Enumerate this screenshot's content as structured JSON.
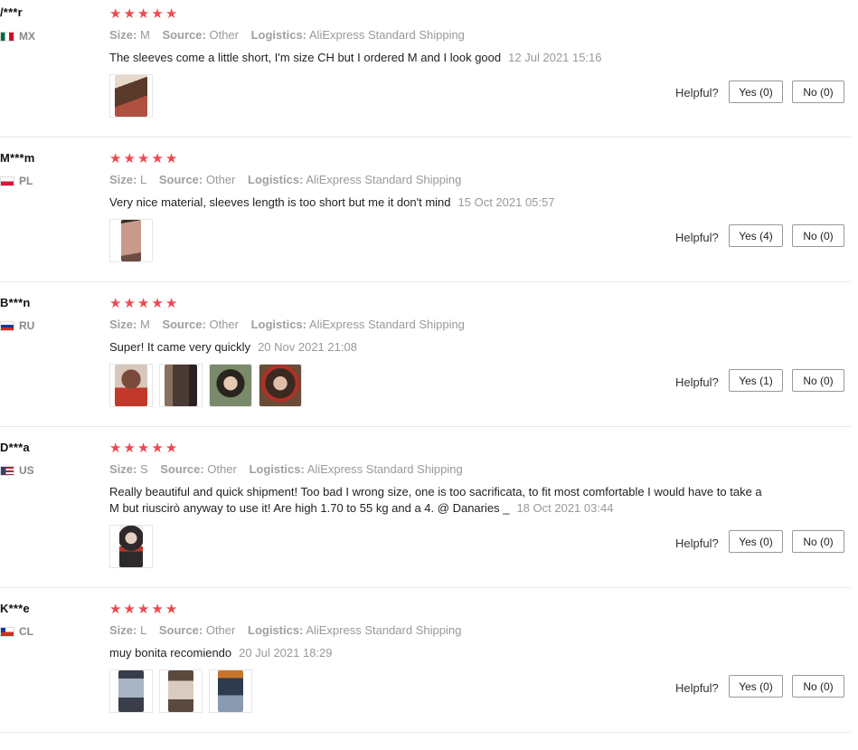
{
  "labels": {
    "size": "Size:",
    "source": "Source:",
    "logistics": "Logistics:",
    "helpful": "Helpful?"
  },
  "reviews": [
    {
      "user": "/***r",
      "country": "MX",
      "flag": [
        "#006847",
        "#ffffff",
        "#ce1126"
      ],
      "size": "M",
      "source": "Other",
      "logistics": "AliExpress Standard Shipping",
      "text": "The sleeves come a little short, I'm size CH but I ordered M and I look good",
      "date": "12 Jul 2021 15:16",
      "yes": "Yes (0)",
      "no": "No (0)",
      "photos": [
        {
          "color": "#5a3a2a",
          "accent": "#b05040"
        }
      ]
    },
    {
      "user": "M***m",
      "country": "PL",
      "flag": [
        "#ffffff",
        "#dc143c"
      ],
      "size": "L",
      "source": "Other",
      "logistics": "AliExpress Standard Shipping",
      "text": "Very nice material, sleeves length is too short but me it don't mind",
      "date": "15 Oct 2021 05:57",
      "yes": "Yes (4)",
      "no": "No (0)",
      "photos": [
        {
          "color": "#c79a8c",
          "accent": "#6e4c44"
        }
      ]
    },
    {
      "user": "B***n",
      "country": "RU",
      "flag": [
        "#ffffff",
        "#0039a6",
        "#d52b1e"
      ],
      "size": "M",
      "source": "Other",
      "logistics": "AliExpress Standard Shipping",
      "text": "Super! It came very quickly",
      "date": "20 Nov 2021 21:08",
      "yes": "Yes (1)",
      "no": "No (0)",
      "photos": [
        {
          "color": "#7a4a3a",
          "accent": "#c0392b"
        },
        {
          "color": "#4a3a34",
          "accent": "#8a7060"
        },
        {
          "color": "#5a4a40",
          "accent": "#e6c8b4"
        },
        {
          "color": "#6b4a36",
          "accent": "#b03028"
        }
      ]
    },
    {
      "user": "D***a",
      "country": "US",
      "flag": [
        "#b22234",
        "#ffffff",
        "#3c3b6e"
      ],
      "size": "S",
      "source": "Other",
      "logistics": "AliExpress Standard Shipping",
      "text": "Really beautiful and quick shipment! Too bad I wrong size, one is too sacrificata, to fit most comfortable I would have to take a M but riuscirò anyway to use it! Are high 1.70 to 55 kg and a 4. @ Danaries _",
      "date": "18 Oct 2021 03:44",
      "yes": "Yes (0)",
      "no": "No (0)",
      "photos": [
        {
          "color": "#2e2a2c",
          "accent": "#c0392b"
        }
      ]
    },
    {
      "user": "K***e",
      "country": "CL",
      "flag": [
        "#ffffff",
        "#d52b1e",
        "#0039a6"
      ],
      "size": "L",
      "source": "Other",
      "logistics": "AliExpress Standard Shipping",
      "text": "muy bonita recomiendo",
      "date": "20 Jul 2021 18:29",
      "yes": "Yes (0)",
      "no": "No (0)",
      "photos": [
        {
          "color": "#3a3e4a",
          "accent": "#a8b4c4"
        },
        {
          "color": "#5a4a3e",
          "accent": "#d8ccc0"
        },
        {
          "color": "#2e3a4e",
          "accent": "#c8742a"
        }
      ]
    }
  ]
}
